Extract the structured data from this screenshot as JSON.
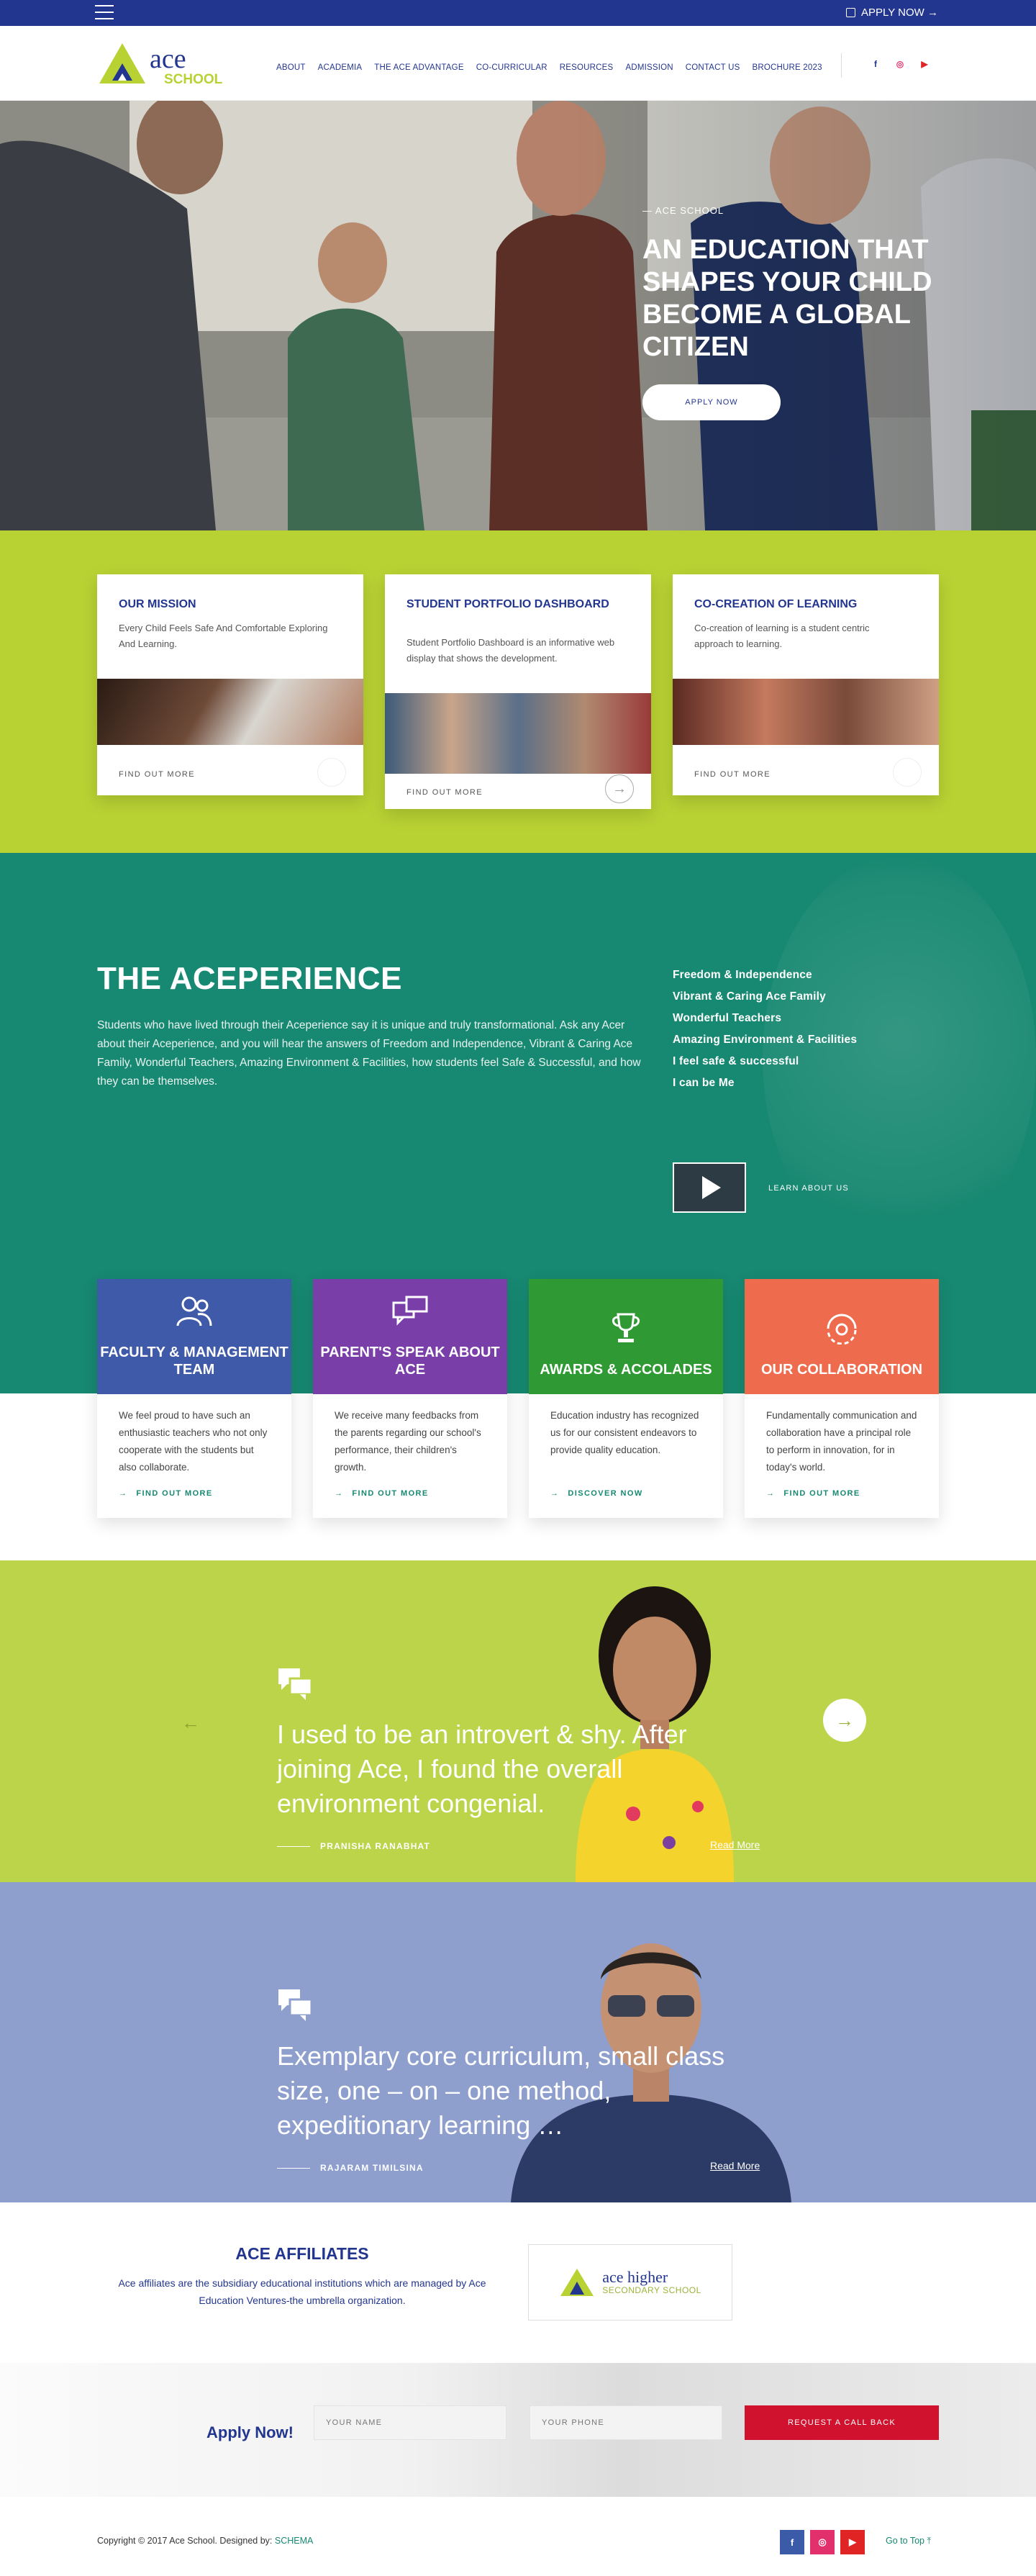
{
  "topbar": {
    "apply_now": "APPLY NOW →"
  },
  "header": {
    "logo_ace": "ace",
    "logo_school": "SCHOOL",
    "nav": [
      "ABOUT",
      "ACADEMIA",
      "THE ACE ADVANTAGE",
      "CO-CURRICULAR",
      "RESOURCES",
      "ADMISSION",
      "CONTACT US",
      "BROCHURE 2023"
    ],
    "social": [
      "f",
      "◎",
      "▶"
    ]
  },
  "hero": {
    "tag": "— ACE SCHOOL",
    "title": "AN EDUCATION THAT SHAPES YOUR CHILD BECOME A GLOBAL CITIZEN",
    "button": "APPLY NOW"
  },
  "cards": [
    {
      "title": "OUR MISSION",
      "text": "Every Child Feels Safe And Comfortable Exploring And Learning.",
      "link": "FIND OUT MORE"
    },
    {
      "title": "STUDENT PORTFOLIO DASHBOARD",
      "text": "Student Portfolio Dashboard is an informative web display that shows the development.",
      "link": "FIND OUT MORE"
    },
    {
      "title": "CO-CREATION OF LEARNING",
      "text": "Co-creation of learning is a student centric approach to learning.",
      "link": "FIND OUT MORE"
    }
  ],
  "aceperience": {
    "title": "THE ACEPERIENCE",
    "text": "Students who have lived through their Aceperience say it is unique and truly transformational. Ask any Acer about their Aceperience, and you will hear the answers of Freedom and Independence, Vibrant & Caring Ace Family, Wonderful Teachers, Amazing Environment & Facilities, how students feel Safe & Successful, and how they can be themselves.",
    "list": [
      "Freedom & Independence",
      "Vibrant & Caring Ace Family",
      "Wonderful Teachers",
      "Amazing Environment & Facilities",
      "I feel safe & successful",
      "I can be Me"
    ],
    "learn": "LEARN ABOUT US"
  },
  "features": [
    {
      "title": "FACULTY & MANAGEMENT TEAM",
      "text": "We feel proud to have such an enthusiastic teachers who not only cooperate with the students but also collaborate.",
      "link": "FIND OUT MORE",
      "color": "#3f5aa8",
      "icon": "people-icon"
    },
    {
      "title": "PARENT'S SPEAK ABOUT ACE",
      "text": "We receive many feedbacks from the parents regarding our school's performance, their children's growth.",
      "link": "FIND OUT MORE",
      "color": "#7a3ea8",
      "icon": "chat-icon"
    },
    {
      "title": "AWARDS & ACCOLADES",
      "text": "Education industry has recognized us for our consistent endeavors to provide quality education.",
      "link": "DISCOVER NOW",
      "color": "#2f9a33",
      "icon": "trophy-icon"
    },
    {
      "title": "OUR COLLABORATION",
      "text": "Fundamentally communication and collaboration have a principal role to perform in innovation, for in today's world.",
      "link": "FIND OUT MORE",
      "color": "#ee6c4d",
      "icon": "collab-icon"
    }
  ],
  "testimonials": [
    {
      "quote": "I used to be an introvert & shy. After joining Ace, I found the overall environment congenial.",
      "name": "PRANISHA RANABHAT",
      "read_more": "Read More"
    },
    {
      "quote": "Exemplary core curriculum, small class size, one – on – one method, expeditionary learning …",
      "name": "RAJARAM TIMILSINA",
      "read_more": "Read More"
    }
  ],
  "affiliates": {
    "title": "ACE AFFILIATES",
    "text": "Ace affiliates are the subsidiary educational institutions which are managed by Ace Education Ventures-the umbrella organization.",
    "logo_line1": "ace higher",
    "logo_line2": "SECONDARY SCHOOL"
  },
  "apply": {
    "title": "Apply Now!",
    "name_placeholder": "YOUR NAME",
    "phone_placeholder": "YOUR PHONE",
    "button": "REQUEST A CALL BACK"
  },
  "footer": {
    "copyright": "Copyright © 2017 Ace School. Designed by:",
    "designer": "SCHEMA",
    "go_to_top": "Go to Top ⤒",
    "social": [
      "f",
      "◎",
      "▶"
    ]
  },
  "colors": {
    "navy": "#23368f",
    "lime": "#b9d233",
    "teal": "#178871",
    "red": "#d0122e",
    "periwinkle": "#8e9fce"
  }
}
